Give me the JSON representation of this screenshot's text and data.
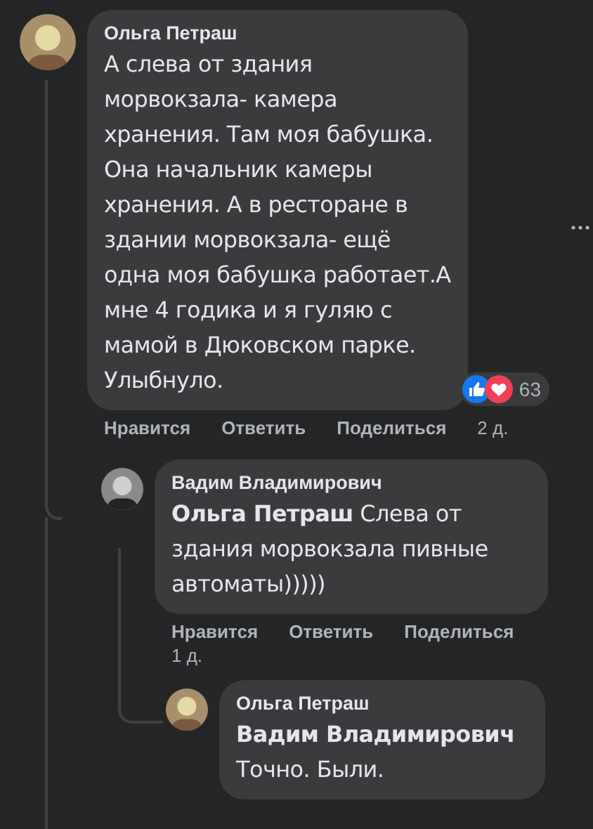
{
  "comment": {
    "author": "Ольга Петраш",
    "body": "А слева от здания морвокзала- камера хранения. Там моя бабушка. Она начальник камеры хранения. А в ресторане в здании морвокзала- ещё одна моя бабушка работает.А мне 4 годика и я гуляю с мамой в Дюковском парке. Улыбнуло.",
    "reactions": [
      {
        "kind": "like"
      },
      {
        "kind": "love"
      }
    ],
    "reaction_count": "63",
    "actions": [
      "Нравится",
      "Ответить",
      "Поделиться"
    ],
    "time": "2 д."
  },
  "replies": [
    {
      "author": "Вадим Владимирович",
      "body": "**Ольга Петраш** Слева от здания морвокзала пивные автоматы)))))",
      "actions": [
        "Нравится",
        "Ответить",
        "Поделиться"
      ],
      "time": "1 д."
    },
    {
      "author": "Ольга Петраш",
      "body": "**Вадим Владимирович** Точно. Были."
    }
  ]
}
